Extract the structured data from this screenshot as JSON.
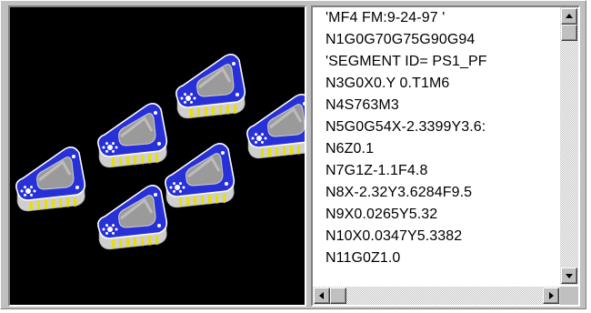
{
  "viewport": {
    "background": "#000000",
    "part_count": 6,
    "part_top_color": "#2830d8",
    "part_edge_color": "#ffffff",
    "part_side_color": "#cfcfcf",
    "part_pocket_color": "#9a9a9a",
    "part_marker_color": "#e8e000"
  },
  "program": {
    "lines": [
      "'MF4   FM:9-24-97 '",
      "N1G0G70G75G90G94",
      "'SEGMENT ID= PS1_PF",
      "N3G0X0.Y 0.T1M6",
      "N4S763M3",
      "N5G0G54X-2.3399Y3.6:",
      "N6Z0.1",
      "N7G1Z-1.1F4.8",
      "N8X-2.32Y3.6284F9.5",
      "N9X0.0265Y5.32",
      "N10X0.0347Y5.3382",
      "N11G0Z1.0"
    ]
  },
  "scrollbars": {
    "vertical_position": 0.0,
    "horizontal_position": 0.0,
    "up_icon": "scroll-up-arrow-icon",
    "down_icon": "scroll-down-arrow-icon",
    "left_icon": "scroll-left-arrow-icon",
    "right_icon": "scroll-right-arrow-icon"
  }
}
